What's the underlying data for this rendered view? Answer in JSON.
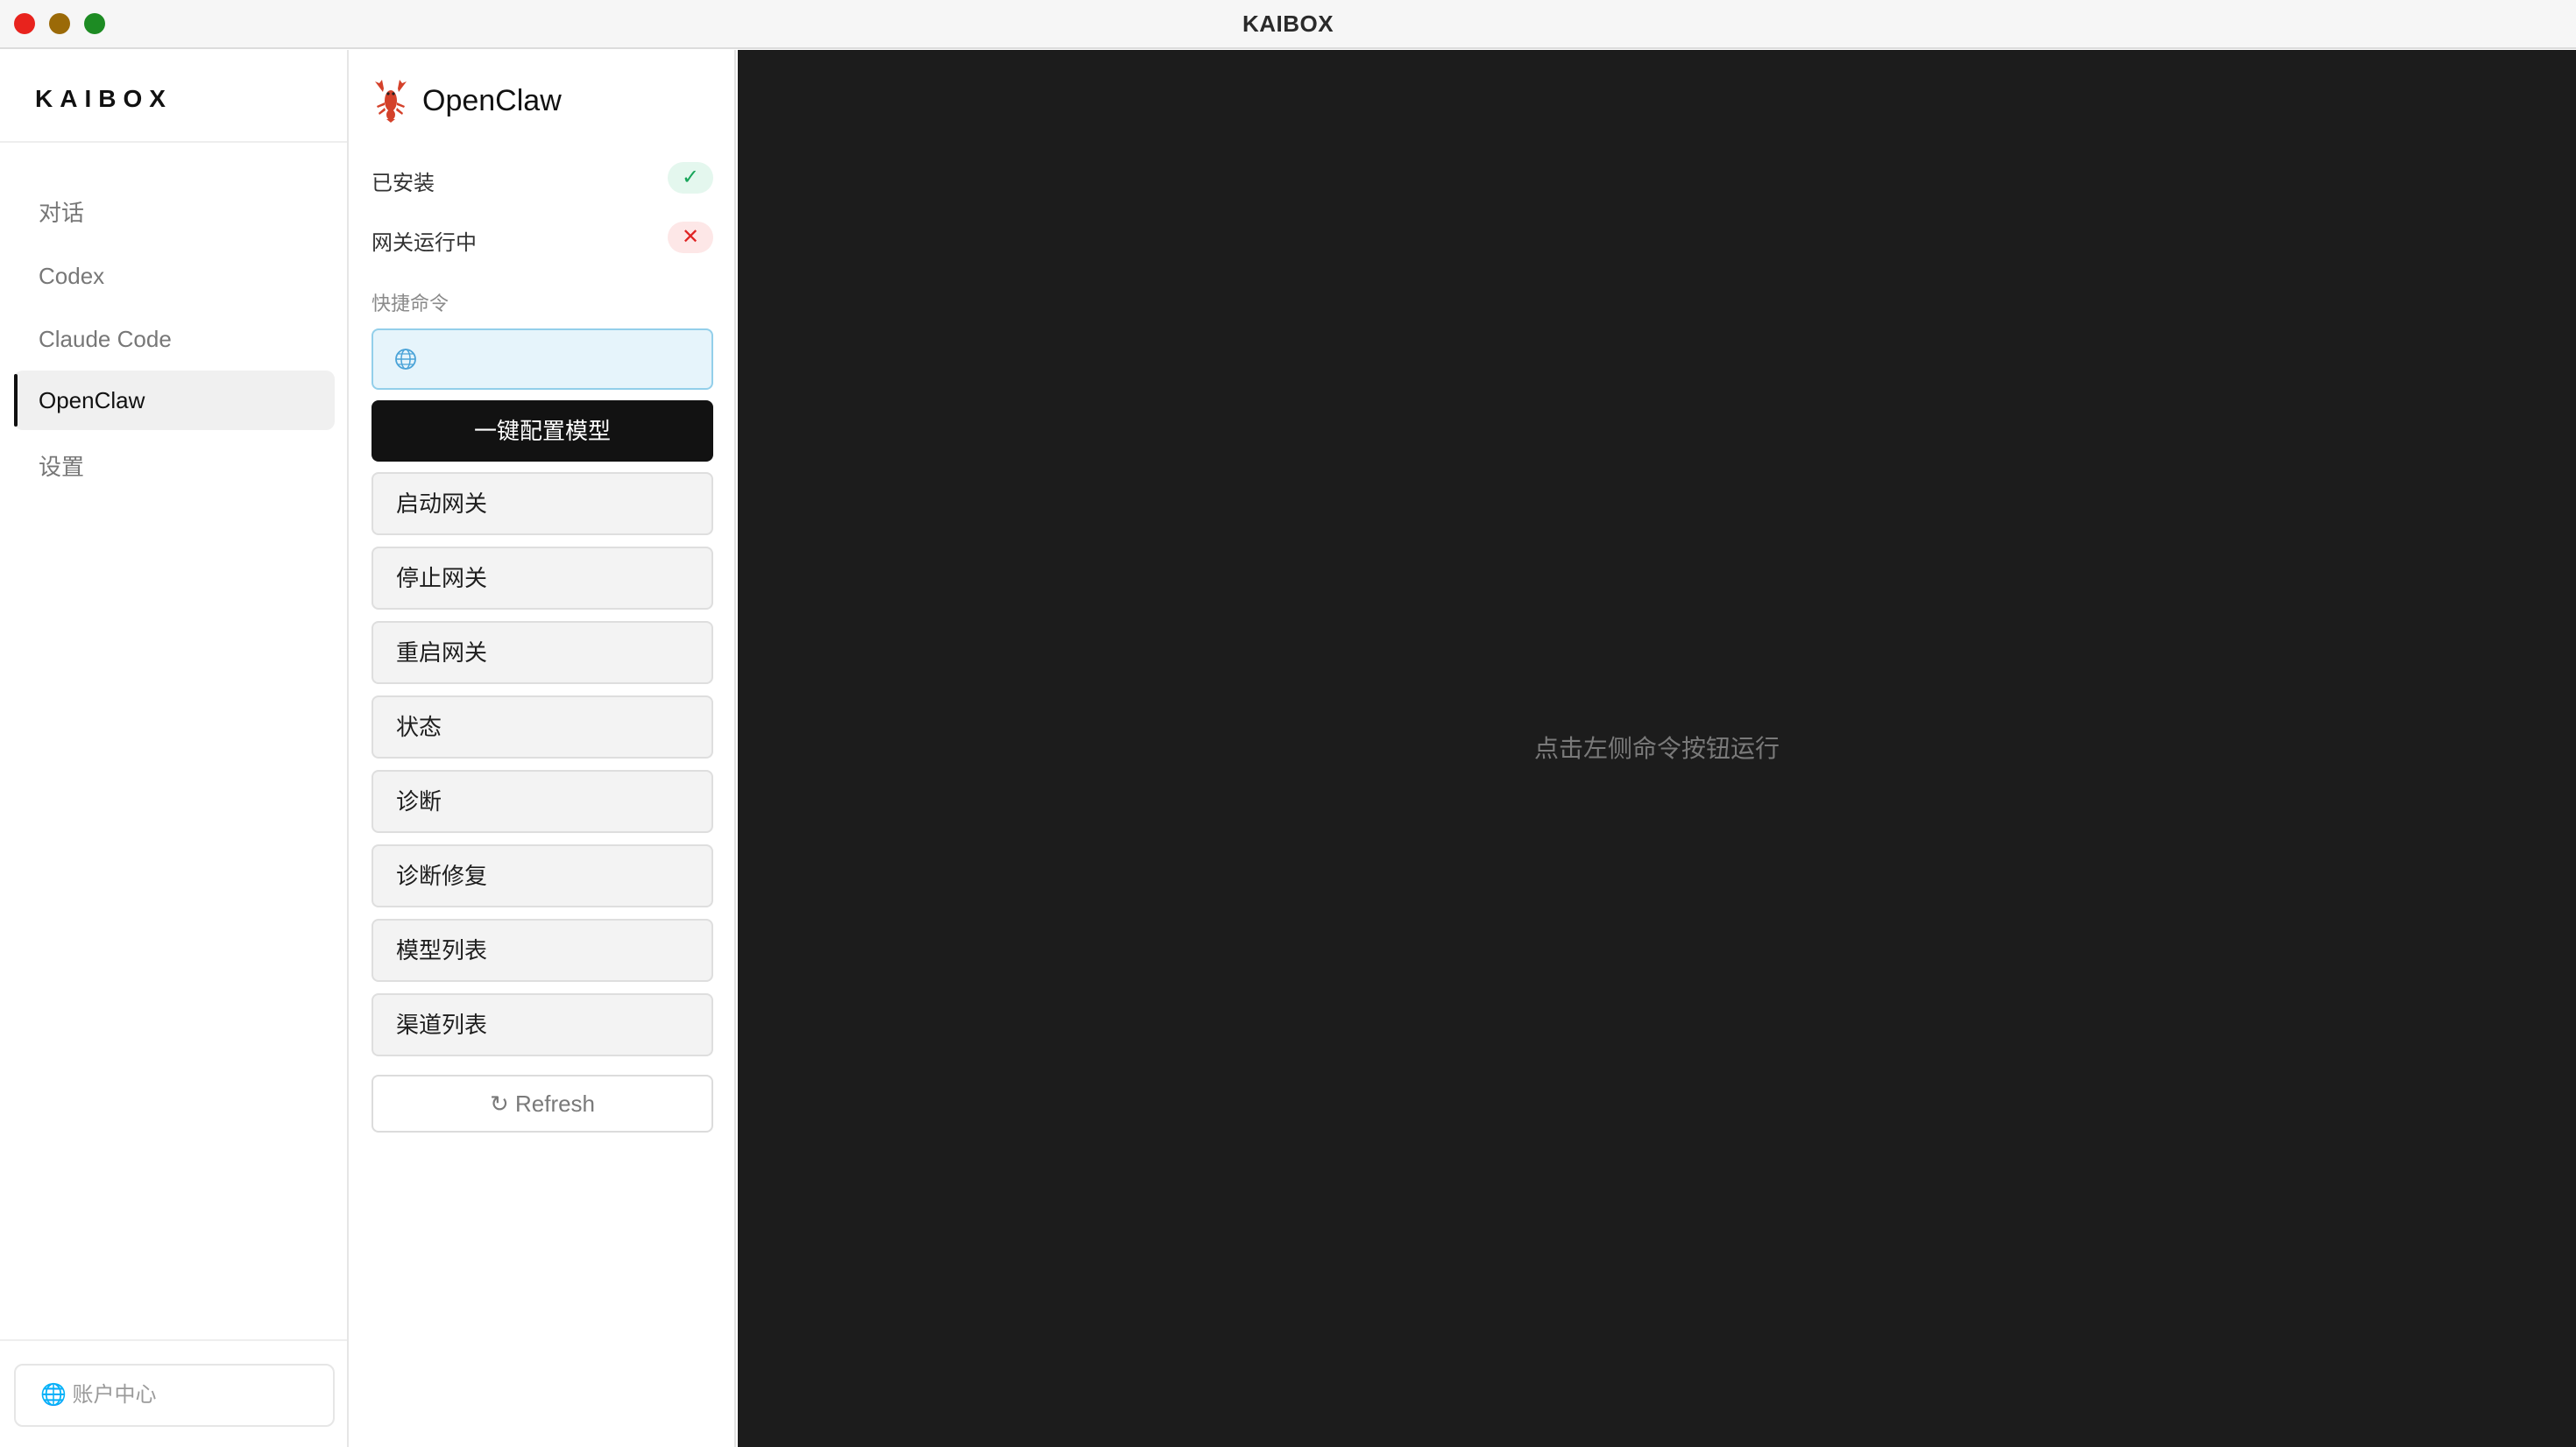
{
  "window": {
    "title": "KAIBOX"
  },
  "sidebar": {
    "logo": "KAIBOX",
    "items": [
      {
        "label": "对话",
        "active": false
      },
      {
        "label": "Codex",
        "active": false
      },
      {
        "label": "Claude Code",
        "active": false
      },
      {
        "label": "OpenClaw",
        "active": true
      },
      {
        "label": "设置",
        "active": false
      }
    ],
    "account_label": "🌐 账户中心"
  },
  "panel": {
    "icon": "lobster-icon",
    "title": "OpenClaw",
    "status": [
      {
        "label": "已安装",
        "state": "ok",
        "symbol": "✓"
      },
      {
        "label": "网关运行中",
        "state": "error",
        "symbol": "✕"
      }
    ],
    "section_label": "快捷命令",
    "quick_input": {
      "icon": "globe-icon",
      "value": "",
      "placeholder": ""
    },
    "primary_button": "一键配置模型",
    "commands": [
      "启动网关",
      "停止网关",
      "重启网关",
      "状态",
      "诊断",
      "诊断修复",
      "模型列表",
      "渠道列表"
    ],
    "refresh_label": "↻ Refresh"
  },
  "output": {
    "hint": "点击左侧命令按钮运行"
  },
  "colors": {
    "accent_dark": "#121212",
    "ok": "#18a55a",
    "error": "#e02424",
    "input_bg": "#e6f4fb",
    "output_bg": "#1c1c1c"
  }
}
